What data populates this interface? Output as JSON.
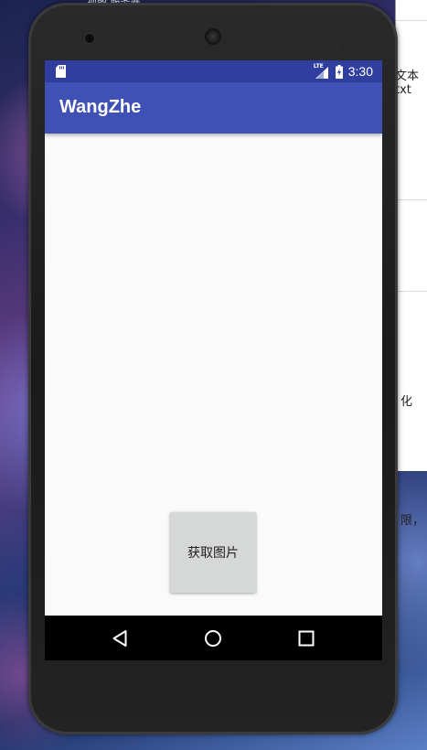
{
  "desktop": {
    "top_text": "视图 服务器…",
    "side_text_1": "文本",
    "side_text_2": "txt",
    "side_text_3": "化",
    "side_text_4": "限，"
  },
  "status_bar": {
    "network_label": "LTE",
    "time": "3:30",
    "icons": [
      "sd-card-icon",
      "signal-icon",
      "battery-charging-icon"
    ]
  },
  "app_bar": {
    "title": "WangZhe"
  },
  "main": {
    "button_label": "获取图片"
  },
  "nav_bar": {
    "icons": [
      "back-icon",
      "home-icon",
      "recents-icon"
    ]
  },
  "colors": {
    "status_bar": "#303f9f",
    "app_bar": "#3f51b5",
    "screen_bg": "#fafafa",
    "button_bg": "#d6d7d7"
  }
}
